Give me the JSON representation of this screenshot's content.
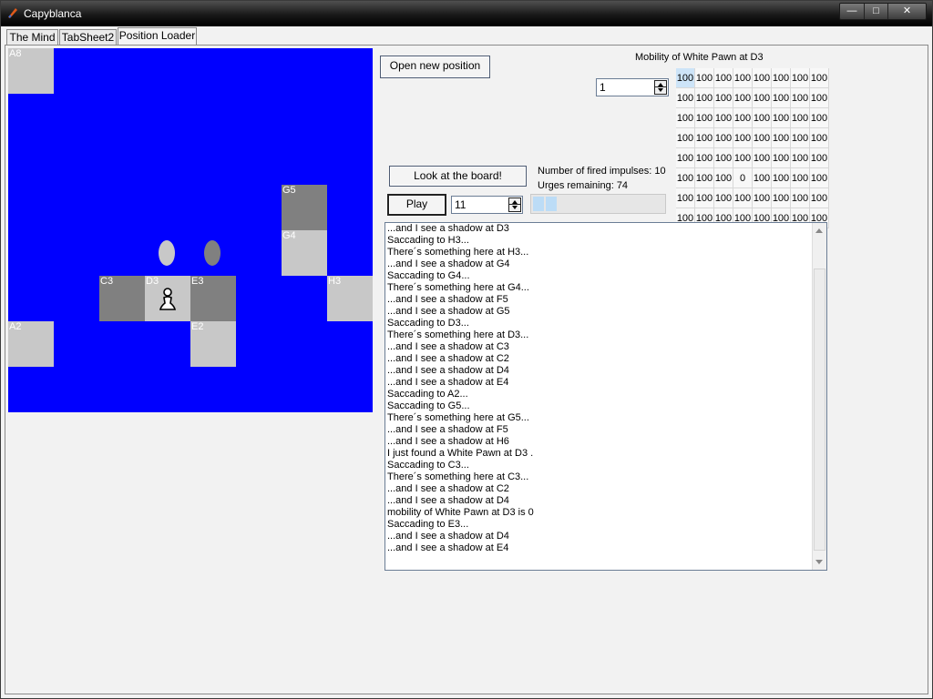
{
  "window": {
    "title": "Capyblanca",
    "minimize": "—",
    "maximize": "□",
    "close": "✕"
  },
  "tabs": [
    {
      "label": "The Mind"
    },
    {
      "label": "TabSheet2"
    },
    {
      "label": "Position Loader",
      "active": true
    }
  ],
  "board": {
    "background_color": "#0000ff",
    "light_square_color": "#c8c8c8",
    "dark_square_color": "#808080",
    "squares": [
      {
        "label": "A8",
        "shade": "light"
      },
      {
        "label": "G5",
        "shade": "dark"
      },
      {
        "label": "G4",
        "shade": "light"
      },
      {
        "label": "C3",
        "shade": "dark"
      },
      {
        "label": "D3",
        "shade": "light",
        "piece": "white-pawn"
      },
      {
        "label": "E3",
        "shade": "dark"
      },
      {
        "label": "H3",
        "shade": "light"
      },
      {
        "label": "A2",
        "shade": "light"
      },
      {
        "label": "E2",
        "shade": "light"
      }
    ],
    "shadows": [
      {
        "color": "#c8c8c8"
      },
      {
        "color": "#808080"
      }
    ]
  },
  "controls": {
    "open_button": "Open new position",
    "look_button": "Look at the board!",
    "play_button": "Play",
    "mobility_spin_value": "1",
    "play_spin_value": "11",
    "impulses_text": "Number of fired impulses: 10",
    "urges_text": "Urges remaining: 74",
    "progress_blocks": 2
  },
  "mobility": {
    "title": "Mobility of White Pawn at D3",
    "rows": [
      [
        "100",
        "100",
        "100",
        "100",
        "100",
        "100",
        "100",
        "100"
      ],
      [
        "100",
        "100",
        "100",
        "100",
        "100",
        "100",
        "100",
        "100"
      ],
      [
        "100",
        "100",
        "100",
        "100",
        "100",
        "100",
        "100",
        "100"
      ],
      [
        "100",
        "100",
        "100",
        "100",
        "100",
        "100",
        "100",
        "100"
      ],
      [
        "100",
        "100",
        "100",
        "100",
        "100",
        "100",
        "100",
        "100"
      ],
      [
        "100",
        "100",
        "100",
        "0",
        "100",
        "100",
        "100",
        "100"
      ],
      [
        "100",
        "100",
        "100",
        "100",
        "100",
        "100",
        "100",
        "100"
      ],
      [
        "100",
        "100",
        "100",
        "100",
        "100",
        "100",
        "100",
        "100"
      ]
    ]
  },
  "log": [
    "...and I see a shadow at D3",
    "Saccading to H3...",
    "There´s something here at H3...",
    "...and I see a shadow at G4",
    "Saccading to G4...",
    "There´s something here at G4...",
    "...and I see a shadow at F5",
    "...and I see a shadow at G5",
    "Saccading to D3...",
    "There´s something here at D3...",
    "...and I see a shadow at C3",
    "...and I see a shadow at C2",
    "...and I see a shadow at D4",
    "...and I see a shadow at E4",
    "Saccading to A2...",
    "Saccading to G5...",
    "There´s something here at G5...",
    "...and I see a shadow at F5",
    "...and I see a shadow at H6",
    "I just found a White Pawn at D3 .",
    "Saccading to C3...",
    "There´s something here at C3...",
    "...and I see a shadow at C2",
    "...and I see a shadow at D4",
    "mobility of White Pawn at D3 is 0",
    "Saccading to E3...",
    "...and I see a shadow at D4",
    "...and I see a shadow at E4"
  ]
}
